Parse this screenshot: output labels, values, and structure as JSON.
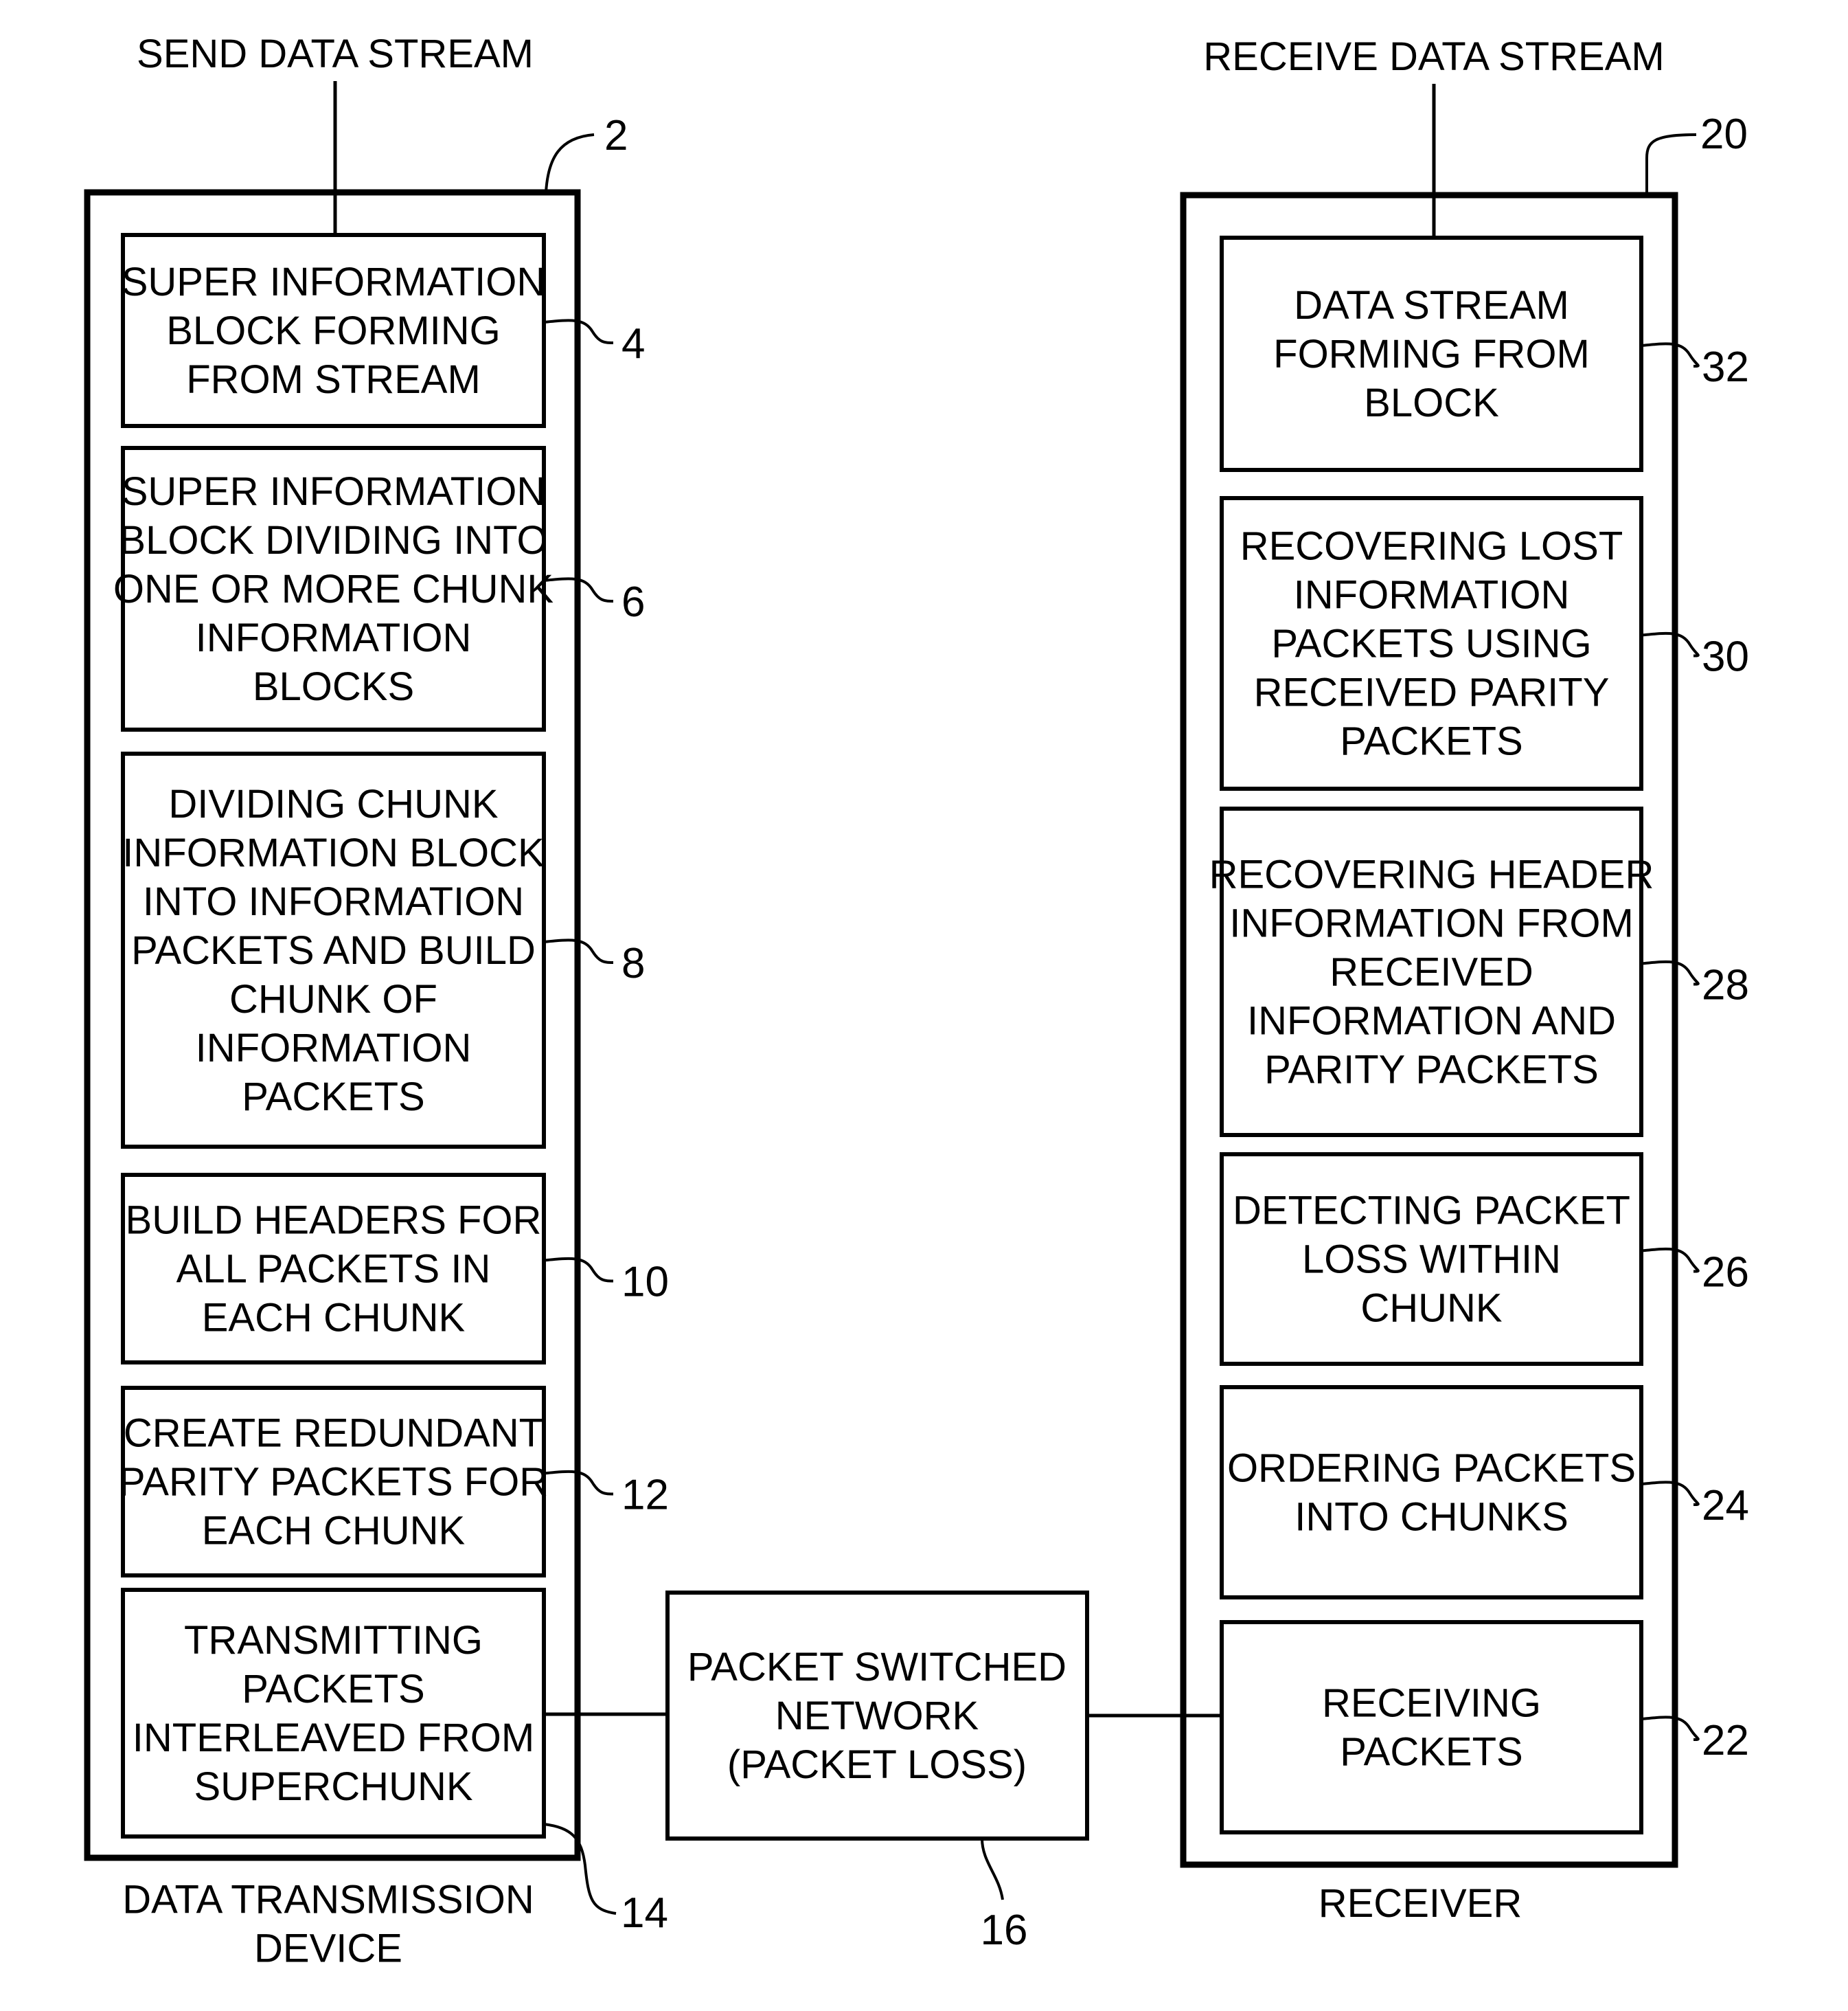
{
  "diagram": {
    "sender": {
      "input_label": "SEND DATA STREAM",
      "ref": "2",
      "caption": [
        "DATA TRANSMISSION",
        "DEVICE"
      ],
      "steps": [
        {
          "ref": "4",
          "lines": [
            "SUPER INFORMATION",
            "BLOCK FORMING",
            "FROM STREAM"
          ]
        },
        {
          "ref": "6",
          "lines": [
            "SUPER INFORMATION",
            "BLOCK DIVIDING INTO",
            "ONE OR MORE CHUNK",
            "INFORMATION",
            "BLOCKS"
          ]
        },
        {
          "ref": "8",
          "lines": [
            "DIVIDING CHUNK",
            "INFORMATION BLOCK",
            "INTO INFORMATION",
            "PACKETS AND BUILD",
            "CHUNK OF",
            "INFORMATION",
            "PACKETS"
          ]
        },
        {
          "ref": "10",
          "lines": [
            "BUILD HEADERS FOR",
            "ALL PACKETS IN",
            "EACH CHUNK"
          ]
        },
        {
          "ref": "12",
          "lines": [
            "CREATE REDUNDANT",
            "PARITY PACKETS FOR",
            "EACH CHUNK"
          ]
        },
        {
          "ref": "14",
          "lines": [
            "TRANSMITTING",
            "PACKETS",
            "INTERLEAVED FROM",
            "SUPERCHUNK"
          ]
        }
      ]
    },
    "network": {
      "ref": "16",
      "lines": [
        "PACKET SWITCHED",
        "NETWORK",
        "(PACKET LOSS)"
      ]
    },
    "receiver": {
      "output_label": "RECEIVE DATA STREAM",
      "ref": "20",
      "caption": [
        "RECEIVER"
      ],
      "steps": [
        {
          "ref": "32",
          "lines": [
            "DATA STREAM",
            "FORMING FROM",
            "BLOCK"
          ]
        },
        {
          "ref": "30",
          "lines": [
            "RECOVERING LOST",
            "INFORMATION",
            "PACKETS USING",
            "RECEIVED PARITY",
            "PACKETS"
          ]
        },
        {
          "ref": "28",
          "lines": [
            "RECOVERING HEADER",
            "INFORMATION FROM",
            "RECEIVED",
            "INFORMATION AND",
            "PARITY PACKETS"
          ]
        },
        {
          "ref": "26",
          "lines": [
            "DETECTING PACKET",
            "LOSS WITHIN",
            "CHUNK"
          ]
        },
        {
          "ref": "24",
          "lines": [
            "ORDERING PACKETS",
            "INTO CHUNKS"
          ]
        },
        {
          "ref": "22",
          "lines": [
            "RECEIVING",
            "PACKETS"
          ]
        }
      ]
    }
  }
}
